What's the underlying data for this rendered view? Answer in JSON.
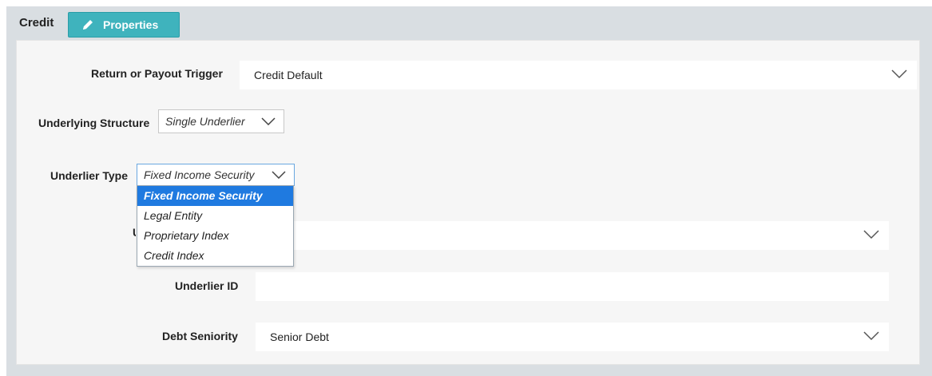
{
  "header": {
    "title": "Credit",
    "properties_label": "Properties"
  },
  "form": {
    "return_trigger": {
      "label": "Return or Payout Trigger",
      "value": "Credit Default"
    },
    "underlying_structure": {
      "label": "Underlying Structure",
      "value": "Single Underlier"
    },
    "underlier_type": {
      "label": "Underlier Type",
      "value": "Fixed Income Security",
      "options": [
        "Fixed Income Security",
        "Legal Entity",
        "Proprietary Index",
        "Credit Index"
      ],
      "selected_index": 0
    },
    "hidden_field": {
      "label_fragment": "U",
      "value": ""
    },
    "underlier_id": {
      "label": "Underlier ID",
      "value": ""
    },
    "debt_seniority": {
      "label": "Debt Seniority",
      "value": "Senior Debt"
    }
  },
  "icons": {
    "edit": "pencil-icon",
    "dropdown": "chevron-down-icon"
  },
  "colors": {
    "accent": "#3fb3bd",
    "selection": "#1f7ae0",
    "panel_bg": "#d9dee2",
    "content_bg": "#f6f6f6"
  }
}
